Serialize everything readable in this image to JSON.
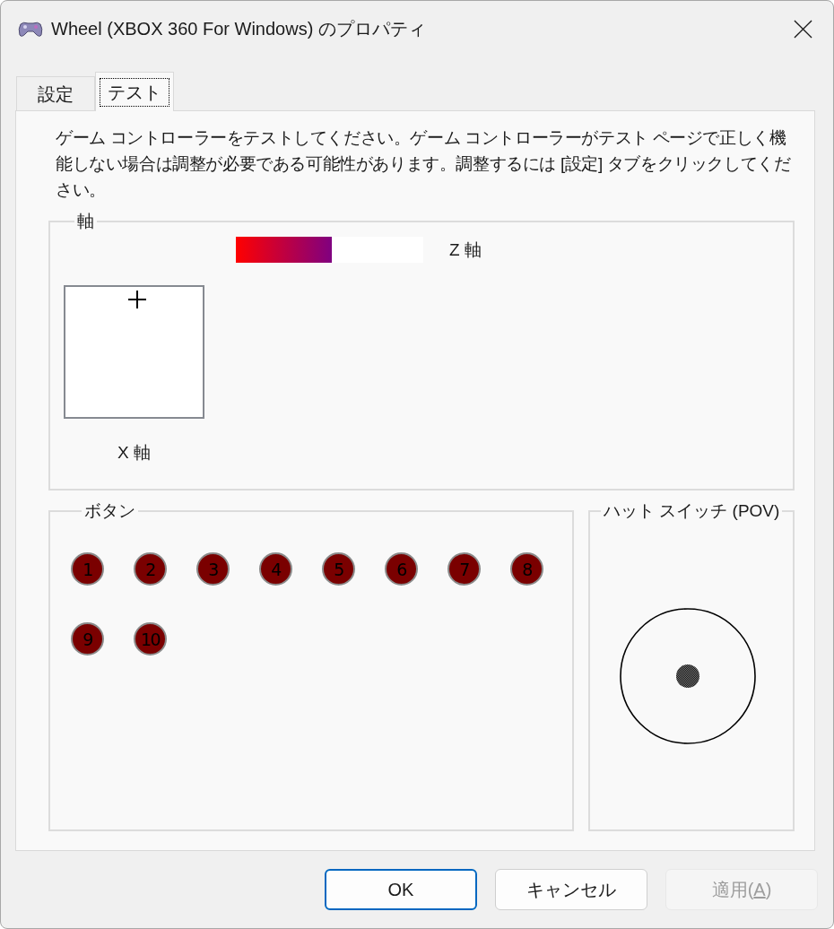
{
  "window": {
    "title": "Wheel (XBOX 360 For Windows) のプロパティ"
  },
  "tabs": [
    {
      "label": "設定",
      "selected": false
    },
    {
      "label": "テスト",
      "selected": true
    }
  ],
  "description": "ゲーム コントローラーをテストしてください。ゲーム コントローラーがテスト ページで正しく機能しない場合は調整が必要である可能性があります。調整するには [設定] タブをクリックしてください。",
  "axes": {
    "title": "軸",
    "z_axis": {
      "label": "Z 軸",
      "level": 0.51
    },
    "x_axis": {
      "label": "X 軸",
      "level": 0.52
    }
  },
  "buttons_group": {
    "title": "ボタン",
    "buttons": [
      {
        "label": "1",
        "pressed": false
      },
      {
        "label": "2",
        "pressed": false
      },
      {
        "label": "3",
        "pressed": false
      },
      {
        "label": "4",
        "pressed": false
      },
      {
        "label": "5",
        "pressed": false
      },
      {
        "label": "6",
        "pressed": false
      },
      {
        "label": "7",
        "pressed": false
      },
      {
        "label": "8",
        "pressed": false
      },
      {
        "label": "9",
        "pressed": false
      },
      {
        "label": "10",
        "pressed": false
      }
    ]
  },
  "pov": {
    "title": "ハット スイッチ (POV)"
  },
  "dialog_buttons": [
    {
      "label": "OK",
      "default": true,
      "disabled": false
    },
    {
      "label": "キャンセル",
      "default": false,
      "disabled": false
    },
    {
      "label": "適用(",
      "access_key": "A",
      "label_end": ")",
      "default": false,
      "disabled": true
    }
  ]
}
